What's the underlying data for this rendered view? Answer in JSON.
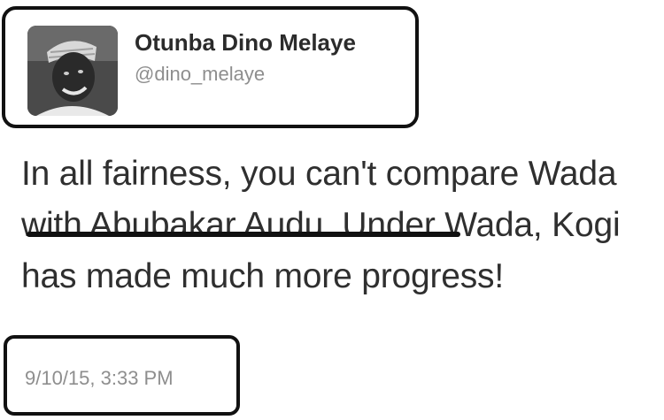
{
  "author": {
    "display_name": "Otunba Dino Melaye",
    "handle": "@dino_melaye"
  },
  "tweet": {
    "text": "In all fairness, you can't compare Wada with Abubakar Audu. Under Wada, Kogi has made much more progress!",
    "timestamp": "9/10/15, 3:33 PM"
  }
}
